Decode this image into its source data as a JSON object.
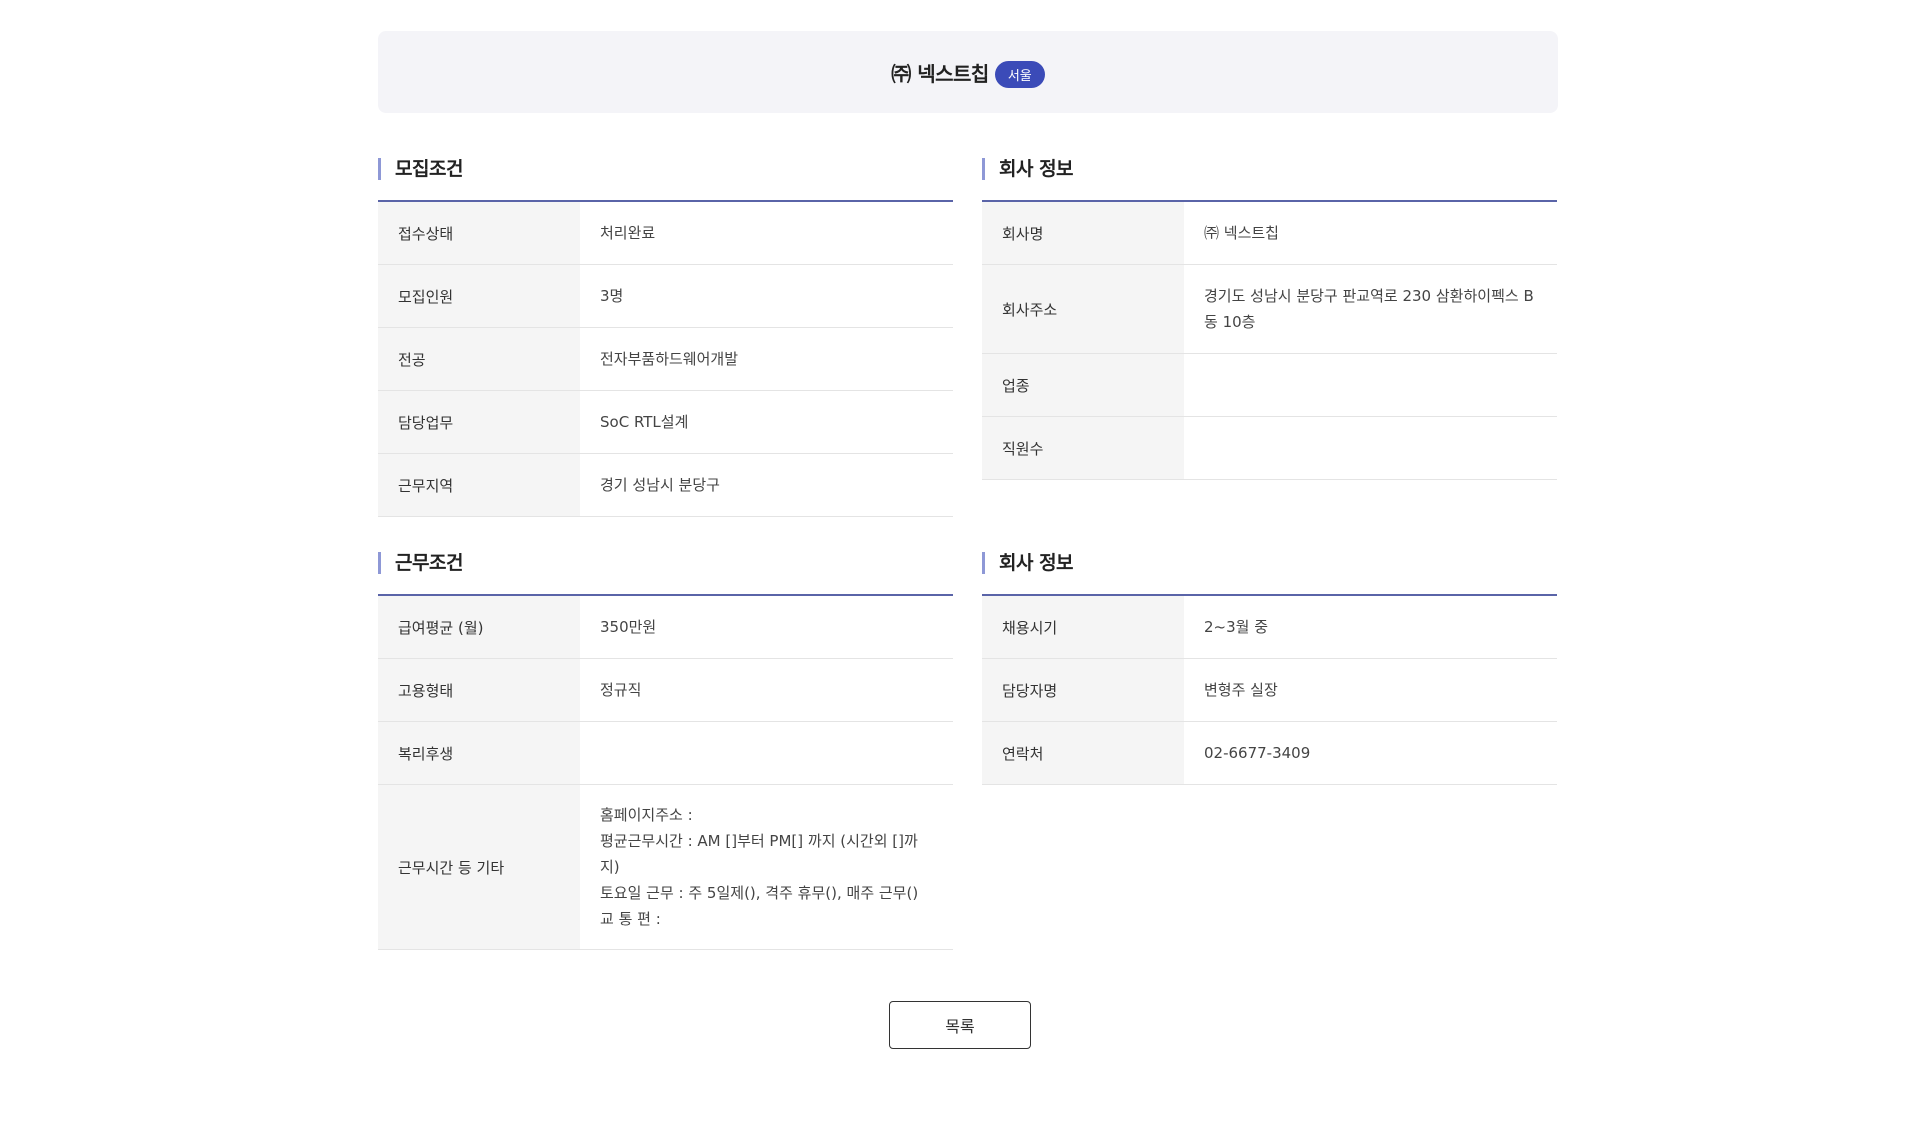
{
  "header": {
    "company_name": "㈜ 넥스트칩",
    "region_badge": "서울"
  },
  "recruit": {
    "title": "모집조건",
    "rows": [
      {
        "label": "접수상태",
        "value": "처리완료"
      },
      {
        "label": "모집인원",
        "value": "3명"
      },
      {
        "label": "전공",
        "value": "전자부품하드웨어개발"
      },
      {
        "label": "담당업무",
        "value": "SoC RTL설계"
      },
      {
        "label": "근무지역",
        "value": "경기 성남시 분당구"
      }
    ]
  },
  "company": {
    "title": "회사 정보",
    "rows": [
      {
        "label": "회사명",
        "value": "㈜ 넥스트칩"
      },
      {
        "label": "회사주소",
        "value": "경기도 성남시 분당구 판교역로 230 삼환하이펙스 B동 10층"
      },
      {
        "label": "업종",
        "value": ""
      },
      {
        "label": "직원수",
        "value": ""
      }
    ]
  },
  "work": {
    "title": "근무조건",
    "rows": [
      {
        "label": "급여평균 (월)",
        "value": "350만원"
      },
      {
        "label": "고용형태",
        "value": "정규직"
      },
      {
        "label": "복리후생",
        "value": ""
      },
      {
        "label": "근무시간 등 기타",
        "value": "홈페이지주소 :\n평균근무시간 : AM []부터 PM[] 까지 (시간외 []까지)\n토요일 근무 : 주 5일제(), 격주 휴무(), 매주 근무()\n교 통 편 :"
      }
    ]
  },
  "contact": {
    "title": "회사 정보",
    "rows": [
      {
        "label": "채용시기",
        "value": "2~3월 중"
      },
      {
        "label": "담당자명",
        "value": "변형주 실장"
      },
      {
        "label": "연락처",
        "value": "02-6677-3409"
      }
    ]
  },
  "footer": {
    "list_button": "목록"
  }
}
